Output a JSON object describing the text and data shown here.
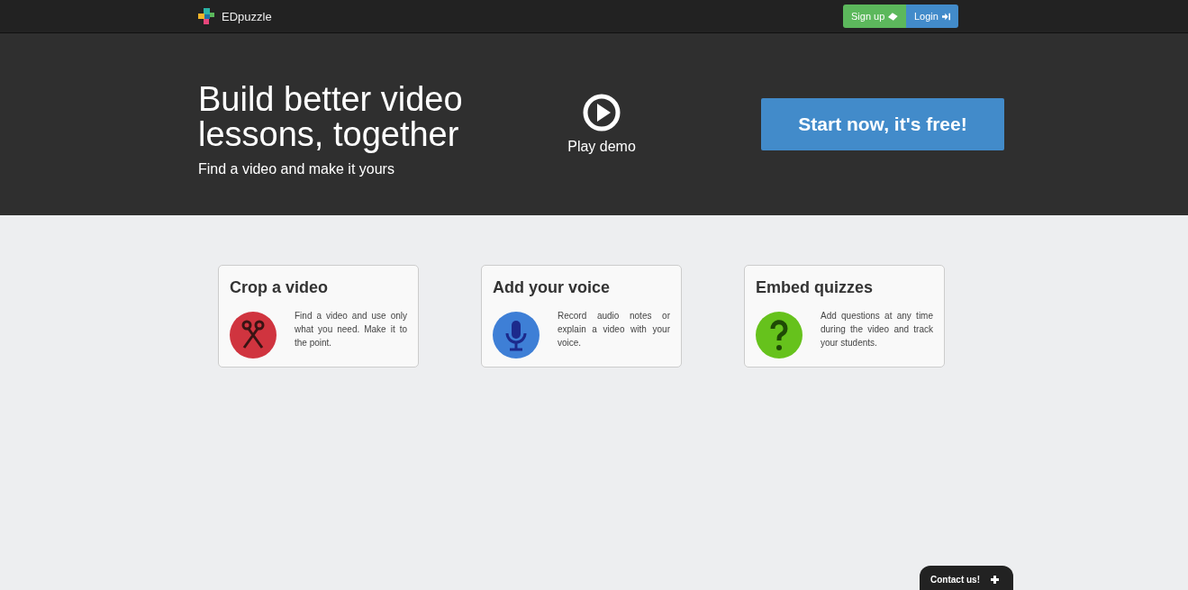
{
  "navbar": {
    "brand": "EDpuzzle",
    "buttons": [
      {
        "label": "Sign up",
        "kind": "signup"
      },
      {
        "label": "Login",
        "kind": "login"
      }
    ]
  },
  "hero": {
    "title": "Build better video lessons, together",
    "subtitle": "Find a video and make it yours",
    "demo": "Play demo",
    "cta": "Start now, it's free!"
  },
  "features": [
    {
      "title": "Crop a video",
      "text": "Find a video and use only what you need. Make it to the point.",
      "kind": "scissors"
    },
    {
      "title": "Add your voice",
      "text": "Record audio notes or explain a video with your voice.",
      "kind": "microphone"
    },
    {
      "title": "Embed quizzes",
      "text": "Add questions at any time during the video and track your students.",
      "kind": "question"
    }
  ],
  "contact": {
    "label": "Contact us!"
  }
}
